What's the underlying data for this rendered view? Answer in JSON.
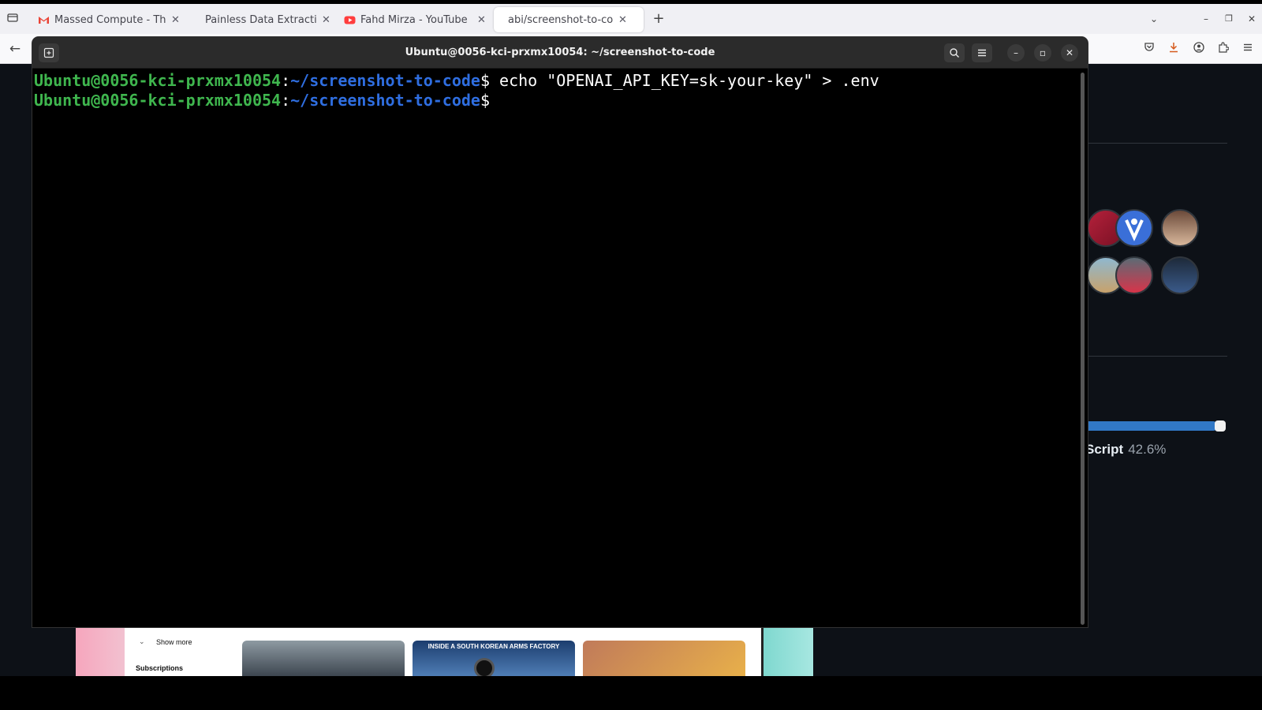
{
  "browser": {
    "tabs": [
      {
        "label": "Massed Compute - Think",
        "favicon": "gmail-icon",
        "active": false
      },
      {
        "label": "Painless Data Extraction",
        "favicon": "",
        "active": false
      },
      {
        "label": "Fahd Mirza - YouTube",
        "favicon": "youtube-icon",
        "active": false
      },
      {
        "label": "abi/screenshot-to-code:",
        "favicon": "",
        "active": true
      }
    ],
    "new_tab": "+"
  },
  "terminal": {
    "title": "Ubuntu@0056-kci-prxmx10054: ~/screenshot-to-code",
    "lines": [
      {
        "user": "Ubuntu@0056-kci-prxmx10054",
        "sep": ":",
        "path": "~/screenshot-to-code",
        "prompt": "$",
        "command": " echo \"OPENAI_API_KEY=sk-your-key\" > .env"
      },
      {
        "user": "Ubuntu@0056-kci-prxmx10054",
        "sep": ":",
        "path": "~/screenshot-to-code",
        "prompt": "$",
        "command": ""
      }
    ]
  },
  "background_page": {
    "language_name": "Script",
    "language_pct": "42.6%",
    "language_progress": 0.98
  },
  "youtube_preview": {
    "show_more": "Show more",
    "subscriptions": "Subscriptions",
    "thumb_caption": "INSIDE A SOUTH KOREAN ARMS FACTORY"
  },
  "colors": {
    "prompt_user": "#3fb64e",
    "prompt_path": "#2f6ee0",
    "terminal_bg": "#000000",
    "header_bg": "#2b2b2b"
  }
}
